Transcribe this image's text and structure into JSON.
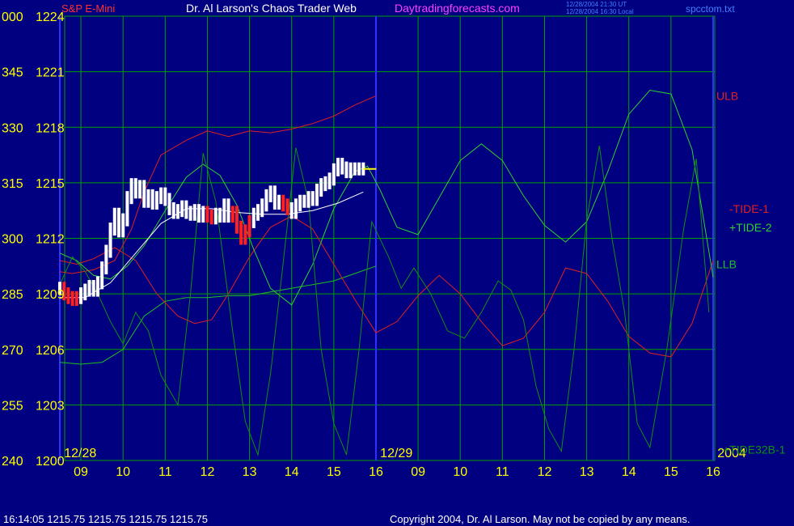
{
  "header": {
    "instrument": "S&P E-Mini",
    "title": "Dr. Al Larson's Chaos Trader Web",
    "site": "Daytradingforecasts.com",
    "update_line1": "12/28/2004 21:30 UT",
    "update_line2": "12/28/2004 16:30 Local",
    "filename": "spcctom.txt"
  },
  "footer": {
    "quote": "16:14:05  1215.75 1215.75 1215.75 1215.75",
    "copyright": "Copyright 2004, Dr. Al Larson. May not be copied by any means."
  },
  "colors": {
    "background": "#000080",
    "grid": "#00a000",
    "day_divider": "#3030ff",
    "price_bars": "#ffffff",
    "down_bars": "#ff2020",
    "last_price": "#ffff00",
    "ulb": "#e02020",
    "llb": "#20c020",
    "tide1": "#e02020",
    "tide2": "#30d030",
    "tide32b": "#109010",
    "avg": "#ffffff",
    "labels_y": "#ffff00",
    "labels_x": "#ffff00",
    "title": "#ffffff",
    "site": "#ff40ff",
    "instrument": "#ff3030",
    "filename": "#4080ff"
  },
  "chart_data": {
    "type": "line",
    "title": "Dr. Al Larson's Chaos Trader Web",
    "xlabel": "",
    "ylabel": "",
    "ylim": [
      1200,
      1224
    ],
    "grid": true,
    "y_ticks": [
      {
        "angle": "000",
        "price": 1224
      },
      {
        "angle": "345",
        "price": 1221
      },
      {
        "angle": "330",
        "price": 1218
      },
      {
        "angle": "315",
        "price": 1215
      },
      {
        "angle": "300",
        "price": 1212
      },
      {
        "angle": "285",
        "price": 1209
      },
      {
        "angle": "270",
        "price": 1206
      },
      {
        "angle": "255",
        "price": 1203
      },
      {
        "angle": "240",
        "price": 1200
      }
    ],
    "x_ticks": [
      {
        "t": 0.5,
        "label": "09"
      },
      {
        "t": 1.5,
        "label": "10"
      },
      {
        "t": 2.5,
        "label": "11"
      },
      {
        "t": 3.5,
        "label": "12"
      },
      {
        "t": 4.5,
        "label": "13"
      },
      {
        "t": 5.5,
        "label": "14"
      },
      {
        "t": 6.5,
        "label": "15"
      },
      {
        "t": 7.5,
        "label": "16"
      },
      {
        "t": 8.5,
        "label": "09"
      },
      {
        "t": 9.5,
        "label": "10"
      },
      {
        "t": 10.5,
        "label": "11"
      },
      {
        "t": 11.5,
        "label": "12"
      },
      {
        "t": 12.5,
        "label": "13"
      },
      {
        "t": 13.5,
        "label": "14"
      },
      {
        "t": 14.5,
        "label": "15"
      },
      {
        "t": 15.5,
        "label": "16"
      }
    ],
    "xlim": [
      0,
      15.5
    ],
    "day_labels": [
      {
        "t": 0.1,
        "label": "12/28"
      },
      {
        "t": 7.6,
        "label": "12/29"
      },
      {
        "t": 15.6,
        "label": "2004"
      }
    ],
    "day_dividers": [
      0,
      7.5,
      15.5
    ],
    "series": [
      {
        "name": "ULB",
        "key": "ulb",
        "x": [
          0,
          0.3,
          0.8,
          1.3,
          1.7,
          2.0,
          2.4,
          3.0,
          3.5,
          4.0,
          4.5,
          5.0,
          5.5,
          6.0,
          6.5,
          7.0,
          7.5
        ],
        "y": [
          1210.2,
          1210.1,
          1210.3,
          1210.8,
          1212.5,
          1214.5,
          1216.5,
          1217.3,
          1217.8,
          1217.5,
          1217.8,
          1217.7,
          1217.9,
          1218.2,
          1218.6,
          1219.2,
          1219.7
        ]
      },
      {
        "name": "LLB",
        "key": "llb",
        "x": [
          0,
          0.5,
          1.0,
          1.5,
          2.0,
          2.5,
          3.0,
          3.5,
          4.0,
          4.5,
          5.0,
          5.5,
          6.0,
          6.5,
          7.0,
          7.5
        ],
        "y": [
          1205.3,
          1205.2,
          1205.3,
          1206.0,
          1207.8,
          1208.6,
          1208.8,
          1208.8,
          1208.9,
          1208.9,
          1209.1,
          1209.3,
          1209.5,
          1209.7,
          1210.1,
          1210.5
        ]
      },
      {
        "name": "-TIDE-1",
        "key": "tide1",
        "x": [
          0,
          0.4,
          0.8,
          1.3,
          1.8,
          2.3,
          2.8,
          3.2,
          3.6,
          4.0,
          4.5,
          5.0,
          5.5,
          6.0,
          6.5,
          7.0,
          7.5,
          8.0,
          8.5,
          9.0,
          9.5,
          10.0,
          10.5,
          11.0,
          11.5,
          12.0,
          12.5,
          13.0,
          13.5,
          14.0,
          14.5,
          15.0,
          15.5
        ],
        "y": [
          1210.8,
          1210.6,
          1210.9,
          1211.5,
          1210.8,
          1209.0,
          1207.8,
          1207.4,
          1207.6,
          1209.0,
          1211.0,
          1212.6,
          1213.2,
          1212.5,
          1210.6,
          1208.7,
          1206.9,
          1207.5,
          1208.9,
          1210.0,
          1209.0,
          1207.5,
          1206.2,
          1206.6,
          1208.0,
          1210.4,
          1210.1,
          1208.6,
          1206.7,
          1205.8,
          1205.6,
          1207.4,
          1210.8
        ]
      },
      {
        "name": "+TIDE-2",
        "key": "tide2",
        "x": [
          0,
          0.4,
          0.8,
          1.2,
          1.6,
          2.0,
          2.5,
          3.0,
          3.4,
          3.8,
          4.2,
          4.6,
          5.0,
          5.5,
          6.0,
          6.5,
          7.0,
          7.3,
          7.6,
          8.0,
          8.5,
          9.0,
          9.5,
          10.0,
          10.5,
          11.0,
          11.5,
          12.0,
          12.5,
          13.0,
          13.5,
          14.0,
          14.5,
          15.0,
          15.5
        ],
        "y": [
          1211.2,
          1210.8,
          1210.0,
          1209.8,
          1210.5,
          1211.6,
          1213.5,
          1215.3,
          1216.0,
          1215.4,
          1213.8,
          1211.4,
          1209.3,
          1208.4,
          1210.6,
          1213.6,
          1215.6,
          1215.9,
          1214.6,
          1212.6,
          1212.2,
          1214.2,
          1216.2,
          1217.1,
          1216.2,
          1214.3,
          1212.7,
          1211.8,
          1212.9,
          1215.6,
          1218.7,
          1220.0,
          1219.8,
          1216.8,
          1209.9
        ]
      },
      {
        "name": "+TIDE32B-1",
        "key": "tide32b",
        "x": [
          0,
          0.3,
          0.6,
          0.9,
          1.2,
          1.5,
          1.8,
          2.1,
          2.4,
          2.8,
          3.1,
          3.4,
          3.7,
          4.1,
          4.4,
          4.7,
          5.0,
          5.3,
          5.6,
          5.9,
          6.2,
          6.5,
          6.8,
          7.1,
          7.4,
          7.8,
          8.1,
          8.4,
          8.8,
          9.2,
          9.6,
          10.0,
          10.4,
          10.7,
          11.0,
          11.3,
          11.6,
          11.9,
          12.2,
          12.5,
          12.8,
          13.1,
          13.4,
          13.7,
          14.0,
          14.4,
          14.8,
          15.1,
          15.4
        ],
        "y": [
          1209.5,
          1211.0,
          1210.2,
          1209.0,
          1207.5,
          1206.3,
          1208.0,
          1207.0,
          1204.6,
          1203.0,
          1209.0,
          1216.6,
          1214.0,
          1207.0,
          1202.1,
          1200.3,
          1204.7,
          1210.7,
          1216.9,
          1214.0,
          1206.0,
          1202.0,
          1200.3,
          1206.0,
          1212.9,
          1211.0,
          1209.3,
          1210.4,
          1209.0,
          1207.0,
          1206.6,
          1208.0,
          1209.7,
          1209.2,
          1207.6,
          1204.0,
          1201.7,
          1200.5,
          1206.0,
          1213.0,
          1217.0,
          1212.0,
          1208.0,
          1202.0,
          1200.7,
          1206.0,
          1212.5,
          1216.3,
          1208.0
        ]
      },
      {
        "name": "average",
        "key": "avg",
        "x": [
          0,
          0.6,
          1.2,
          1.8,
          2.4,
          3.0,
          3.6,
          4.2,
          4.8,
          5.4,
          6.0,
          6.6,
          7.2
        ],
        "y": [
          1208.8,
          1208.8,
          1209.6,
          1211.2,
          1212.8,
          1213.6,
          1213.6,
          1213.4,
          1213.3,
          1213.3,
          1213.5,
          1213.9,
          1214.5
        ]
      }
    ],
    "price": {
      "x": [
        0.0,
        0.1,
        0.2,
        0.3,
        0.4,
        0.5,
        0.6,
        0.7,
        0.8,
        0.9,
        1.0,
        1.1,
        1.2,
        1.3,
        1.4,
        1.5,
        1.6,
        1.7,
        1.8,
        1.9,
        2.0,
        2.1,
        2.2,
        2.3,
        2.4,
        2.5,
        2.6,
        2.7,
        2.8,
        2.9,
        3.0,
        3.1,
        3.2,
        3.3,
        3.4,
        3.5,
        3.6,
        3.7,
        3.8,
        3.9,
        4.0,
        4.1,
        4.2,
        4.3,
        4.4,
        4.5,
        4.6,
        4.7,
        4.8,
        4.9,
        5.0,
        5.1,
        5.2,
        5.3,
        5.4,
        5.5,
        5.6,
        5.7,
        5.8,
        5.9,
        6.0,
        6.1,
        6.2,
        6.3,
        6.4,
        6.5,
        6.6,
        6.7,
        6.8,
        6.9,
        7.0,
        7.1,
        7.2
      ],
      "close": [
        1209.3,
        1209.0,
        1208.8,
        1208.7,
        1208.8,
        1209.0,
        1209.2,
        1209.4,
        1209.2,
        1209.6,
        1210.4,
        1211.3,
        1212.5,
        1213.3,
        1212.4,
        1213.0,
        1214.2,
        1214.9,
        1214.5,
        1214.8,
        1214.0,
        1214.3,
        1213.9,
        1214.2,
        1214.4,
        1214.1,
        1213.6,
        1213.4,
        1213.5,
        1213.7,
        1213.4,
        1213.3,
        1213.5,
        1213.2,
        1213.4,
        1213.2,
        1213.1,
        1213.3,
        1213.2,
        1213.8,
        1213.2,
        1213.4,
        1212.6,
        1212.0,
        1212.4,
        1212.9,
        1213.3,
        1213.5,
        1213.8,
        1214.3,
        1214.5,
        1213.9,
        1214.0,
        1213.8,
        1213.6,
        1213.4,
        1213.8,
        1214.0,
        1214.0,
        1214.2,
        1214.1,
        1214.6,
        1214.9,
        1215.0,
        1215.2,
        1215.7,
        1216.0,
        1215.8,
        1215.6,
        1215.75,
        1215.75,
        1215.75,
        1215.75
      ],
      "down_index": [
        1,
        2,
        3,
        4,
        35,
        36,
        41,
        42,
        43,
        44,
        45,
        53,
        54
      ],
      "last": 1215.75
    },
    "annotations": [
      {
        "text": "ULB",
        "key": "ulb"
      },
      {
        "text": "-TIDE-1",
        "key": "tide1"
      },
      {
        "text": "+TIDE-2",
        "key": "tide2"
      },
      {
        "text": "LLB",
        "key": "llb"
      },
      {
        "text": "+TIDE32B-1",
        "key": "tide32b"
      }
    ]
  }
}
